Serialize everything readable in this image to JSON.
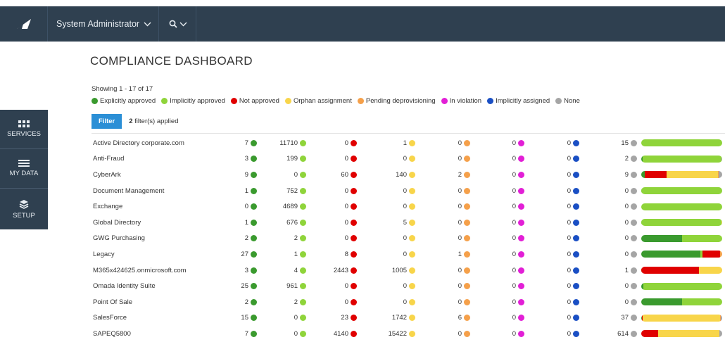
{
  "header": {
    "user": "System Administrator"
  },
  "nav": [
    {
      "label": "SERVICES",
      "icon": "grid-icon"
    },
    {
      "label": "MY DATA",
      "icon": "menu-icon"
    },
    {
      "label": "SETUP",
      "icon": "layers-icon"
    }
  ],
  "page": {
    "title": "COMPLIANCE DASHBOARD",
    "showing": "Showing 1 - 17 of 17",
    "filter_label": "Filter",
    "filters_count": "2",
    "filters_suffix": " filter(s) applied"
  },
  "colors": {
    "explicit": "#3a9a2e",
    "implicit": "#8fd43a",
    "not": "#e00000",
    "orphan": "#f8d54a",
    "pending": "#f5a04a",
    "violation": "#e21fd6",
    "assigned": "#1a4fc4",
    "none": "#a5a5a5"
  },
  "legend": [
    {
      "label": "Explicitly approved",
      "color": "#3a9a2e"
    },
    {
      "label": "Implicitly approved",
      "color": "#8fd43a"
    },
    {
      "label": "Not approved",
      "color": "#e00000"
    },
    {
      "label": "Orphan assignment",
      "color": "#f8d54a"
    },
    {
      "label": "Pending deprovisioning",
      "color": "#f5a04a"
    },
    {
      "label": "In violation",
      "color": "#e21fd6"
    },
    {
      "label": "Implicitly assigned",
      "color": "#1a4fc4"
    },
    {
      "label": "None",
      "color": "#a5a5a5"
    }
  ],
  "rows": [
    {
      "name": "Active Directory corporate.com",
      "values": [
        "7",
        "11710",
        "0",
        "1",
        "0",
        "0",
        "0",
        "15"
      ]
    },
    {
      "name": "Anti-Fraud",
      "values": [
        "3",
        "199",
        "0",
        "0",
        "0",
        "0",
        "0",
        "2"
      ]
    },
    {
      "name": "CyberArk",
      "values": [
        "9",
        "0",
        "60",
        "140",
        "2",
        "0",
        "0",
        "9"
      ]
    },
    {
      "name": "Document Management",
      "values": [
        "1",
        "752",
        "0",
        "0",
        "0",
        "0",
        "0",
        "0"
      ]
    },
    {
      "name": "Exchange",
      "values": [
        "0",
        "4689",
        "0",
        "0",
        "0",
        "0",
        "0",
        "0"
      ]
    },
    {
      "name": "Global Directory",
      "values": [
        "1",
        "676",
        "0",
        "5",
        "0",
        "0",
        "0",
        "0"
      ]
    },
    {
      "name": "GWG Purchasing",
      "values": [
        "2",
        "2",
        "0",
        "0",
        "0",
        "0",
        "0",
        "0"
      ]
    },
    {
      "name": "Legacy",
      "values": [
        "27",
        "1",
        "8",
        "0",
        "1",
        "0",
        "0",
        "0"
      ]
    },
    {
      "name": "M365x424625.onmicrosoft.com",
      "values": [
        "3",
        "4",
        "2443",
        "1005",
        "0",
        "0",
        "0",
        "1"
      ]
    },
    {
      "name": "Omada Identity Suite",
      "values": [
        "25",
        "961",
        "0",
        "0",
        "0",
        "0",
        "0",
        "0"
      ]
    },
    {
      "name": "Point Of Sale",
      "values": [
        "2",
        "2",
        "0",
        "0",
        "0",
        "0",
        "0",
        "0"
      ]
    },
    {
      "name": "SalesForce",
      "values": [
        "15",
        "0",
        "23",
        "1742",
        "6",
        "0",
        "0",
        "37"
      ]
    },
    {
      "name": "SAPEQ5800",
      "values": [
        "7",
        "0",
        "4140",
        "15422",
        "0",
        "0",
        "0",
        "614"
      ]
    }
  ]
}
